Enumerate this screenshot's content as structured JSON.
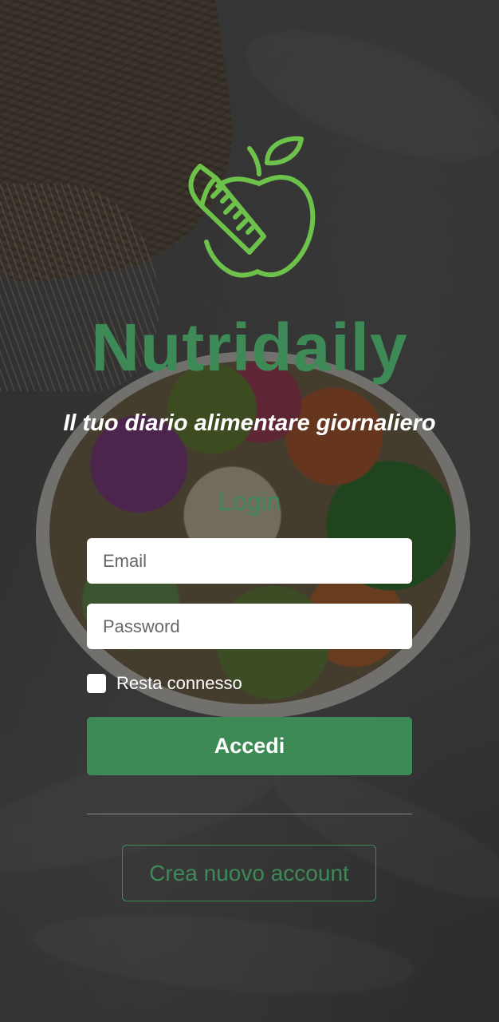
{
  "app": {
    "title": "Nutridaily",
    "tagline": "Il tuo diario alimentare giornaliero"
  },
  "login": {
    "heading": "Login",
    "email_placeholder": "Email",
    "password_placeholder": "Password",
    "remember_label": "Resta connesso",
    "remember_checked": false,
    "submit_label": "Accedi",
    "create_account_label": "Crea nuovo account"
  },
  "icons": {
    "logo": "apple-measuring-tape-icon"
  },
  "colors": {
    "brand_green": "#3e8a57",
    "logo_green": "#6cc24a",
    "text_white": "#ffffff"
  }
}
